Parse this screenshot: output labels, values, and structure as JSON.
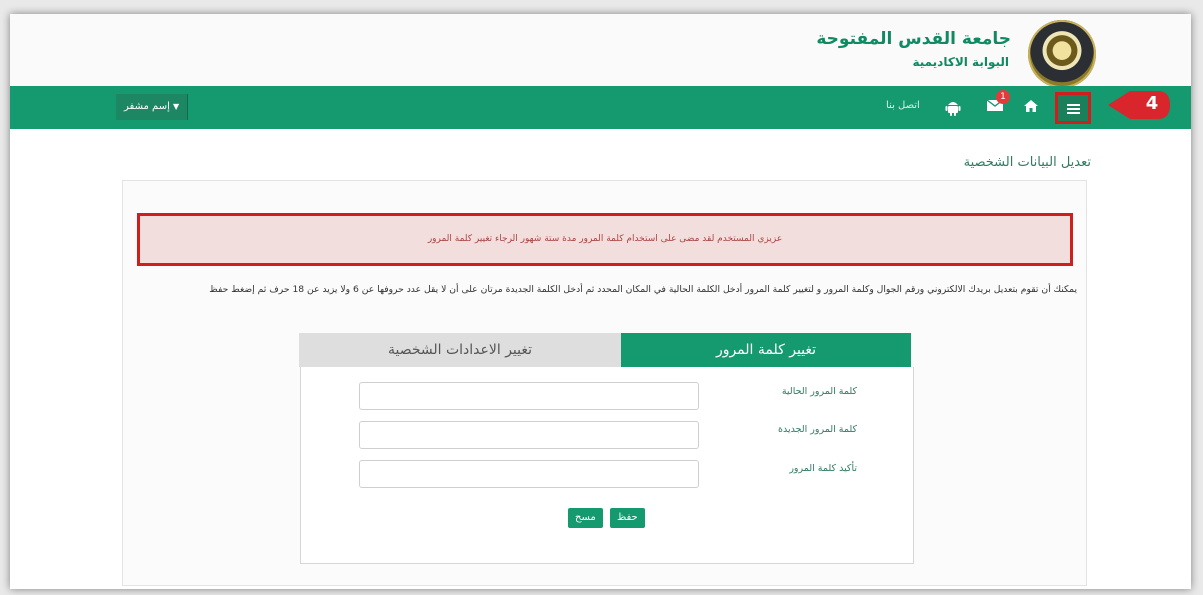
{
  "header": {
    "university_name": "جامعة القدس المفتوحة",
    "portal_name": "البوابة الاكاديمية"
  },
  "navbar": {
    "contact_label": "اتصل بنا",
    "mail_badge": "1",
    "user_menu_label": "إسم مشفر",
    "callout_number": "4",
    "accent_color": "#15996e",
    "highlight_color": "#d21d1d"
  },
  "page": {
    "title": "تعديل البيانات الشخصية",
    "alert_text": "عزيزي المستخدم لقد مضى على استخدام كلمة المرور مدة ستة شهور الرجاء تغيير كلمة المرور",
    "instructions": "يمكنك أن تقوم بتعديل بريدك الالكتروني ورقم الجوال وكلمة المرور و لتغيير كلمة المرور أدخل الكلمة الحالية في المكان المحدد ثم أدخل الكلمة الجديدة مرتان على أن لا يقل عدد حروفها عن 6 ولا يزيد عن 18 حرف ثم إضغط حفظ"
  },
  "tabs": [
    {
      "label": "تغيير كلمة المرور",
      "active": true
    },
    {
      "label": "تغيير الاعدادات الشخصية",
      "active": false
    }
  ],
  "form": {
    "current_password_label": "كلمة المرور الحالية",
    "new_password_label": "كلمة المرور الجديدة",
    "confirm_password_label": "تأكيد كلمة المرور",
    "current_password_value": "",
    "new_password_value": "",
    "confirm_password_value": "",
    "save_label": "حفظ",
    "clear_label": "مسح"
  },
  "icons": [
    "menu-icon",
    "home-icon",
    "mail-icon",
    "android-icon",
    "caret-down-icon"
  ]
}
